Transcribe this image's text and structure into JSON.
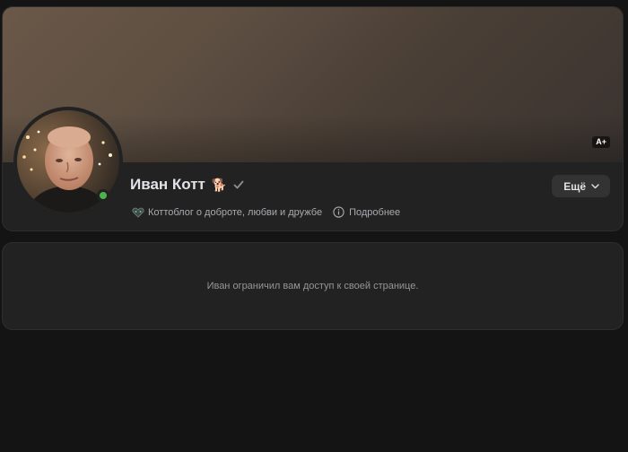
{
  "profile": {
    "name": "Иван Котт",
    "name_emoji": "🐕",
    "status_text": "Коттоблог о доброте, любви и дружбе",
    "details_label": "Подробнее",
    "more_button_label": "Ещё",
    "cover_badge": "A+",
    "online": true
  },
  "access_notice": {
    "text": "Иван ограничил вам доступ к своей странице."
  },
  "colors": {
    "page_background": "#141414",
    "card_background": "#222222",
    "online_indicator": "#4bb34b",
    "text_primary": "#e1e3e6",
    "text_secondary": "#a8abaf"
  },
  "icons": {
    "verified": "check-icon",
    "status": "heart-icon",
    "details": "info-icon",
    "more": "chevron-down-icon"
  }
}
